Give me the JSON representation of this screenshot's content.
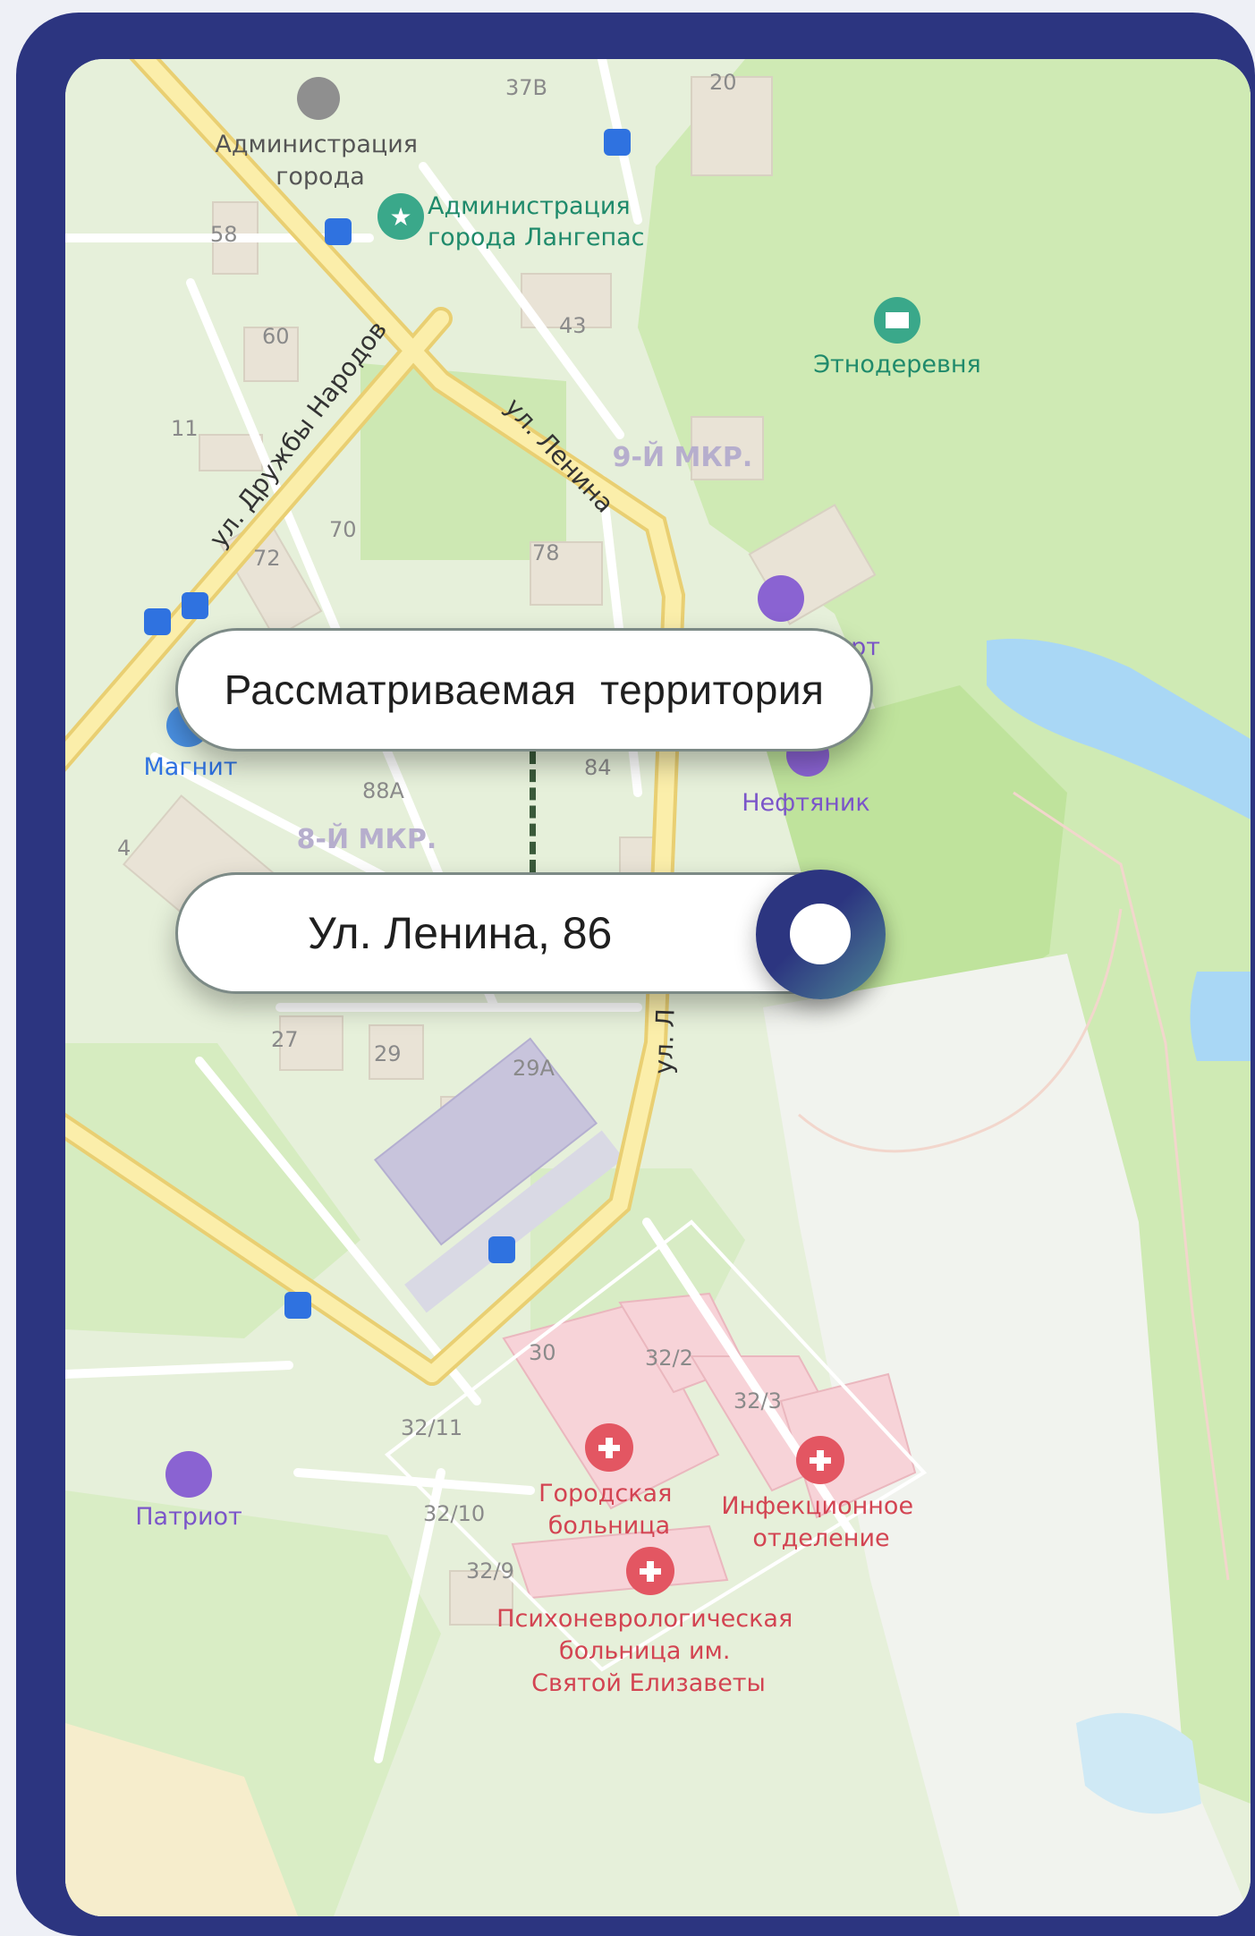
{
  "callouts": {
    "territory": "Рассматриваемая  территория",
    "address": "Ул. Ленина, 86"
  },
  "streets": {
    "druzhby": "ул. Дружбы Народов",
    "lenina_top": "ул. Ленина",
    "lenina_bottom": "ул. Л"
  },
  "districts": {
    "mkr9": "9-Й МКР.",
    "mkr8": "8-Й МКР."
  },
  "pois": {
    "admin_gray": [
      "Администрация",
      "города"
    ],
    "admin_green": [
      "Администрация",
      "города Лангепас"
    ],
    "ethno": "Этнодеревня",
    "langepas_sport": "Лангепас-спорт",
    "magnit": "Магнит",
    "neftyanik": "Нефтяник",
    "patriot": "Патриот",
    "city_hospital": [
      "Городская",
      "больница"
    ],
    "infection": [
      "Инфекционное",
      "отделение"
    ],
    "psycho": [
      "Психоневрологическая",
      "больница им.",
      "Святой Елизаветы"
    ]
  },
  "house_numbers": [
    "37В",
    "20",
    "58",
    "43",
    "60",
    "11",
    "70",
    "72",
    "78",
    "88А",
    "84",
    "4",
    "27",
    "29",
    "29А",
    "30",
    "32/2",
    "32/3",
    "32/11",
    "32/10",
    "32/9"
  ],
  "colors": {
    "frame": "#2c3580",
    "park": "#cdeab3",
    "water": "#a9d7f5",
    "road_major": "#f6e08a",
    "hospital": "#f9d7dc",
    "poi_purple": "#8a63d2",
    "poi_red": "#e35662",
    "poi_green": "#3aa88a"
  }
}
